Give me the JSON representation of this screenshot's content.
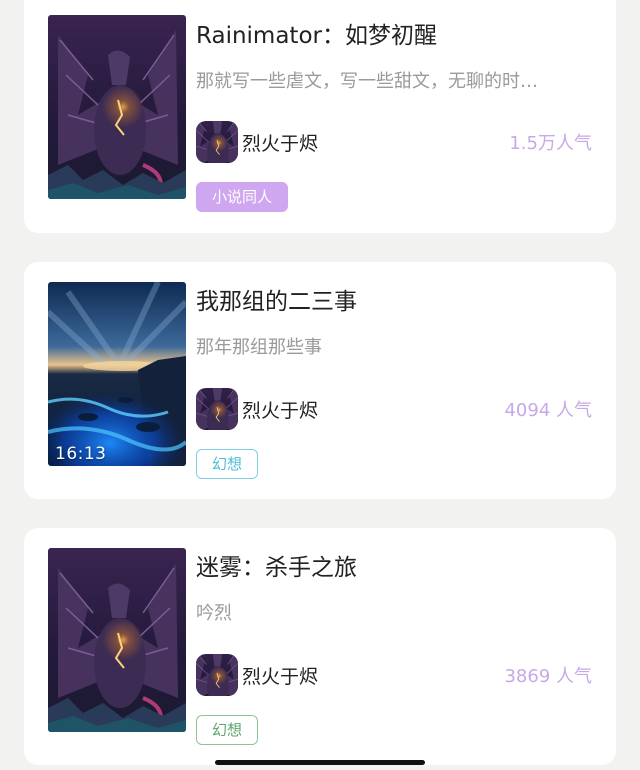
{
  "books": [
    {
      "title": "Rainimator：如梦初醒",
      "description": "那就写一些虐文，写一些甜文，无聊的时…",
      "author": "烈火于烬",
      "popularity": "1.5万人气",
      "tag": "小说同人",
      "cover": "dragon-art"
    },
    {
      "title": "我那组的二三事",
      "description": "那年那组那些事",
      "author": "烈火于烬",
      "popularity": "4094 人气",
      "tag": "幻想",
      "cover": "glowing-beach-photo",
      "cover_overlay_text": "16:13"
    },
    {
      "title": "迷雾：杀手之旅",
      "description": "吟烈",
      "author": "烈火于烬",
      "popularity": "3869 人气",
      "tag": "幻想",
      "cover": "dragon-art"
    }
  ],
  "colors": {
    "popularity": "#c8a8e6",
    "tag_fiction_bg": "#cfa6f0",
    "tag_fantasy_cyan": "#4fbcd8",
    "tag_fantasy_green": "#5fa46a"
  }
}
